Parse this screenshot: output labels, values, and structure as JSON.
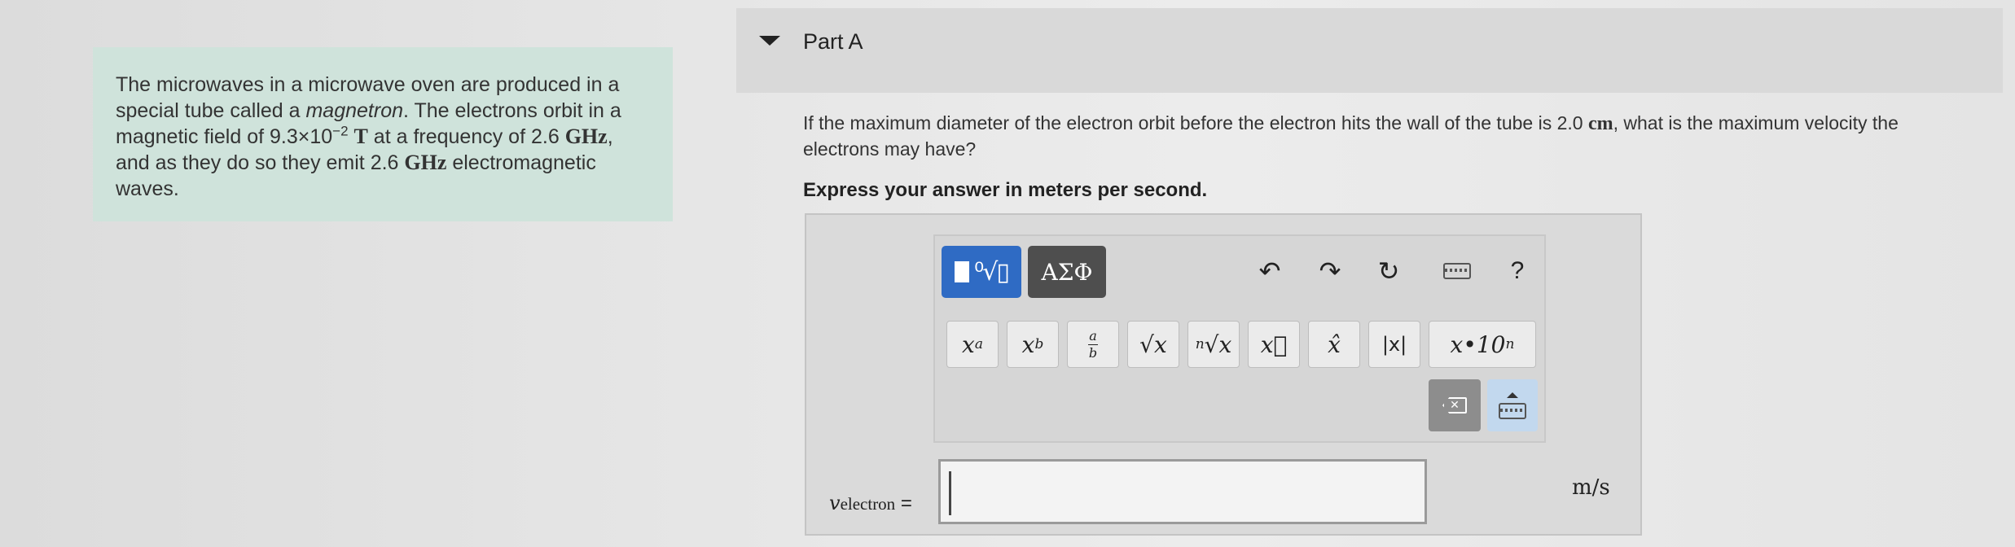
{
  "problem": {
    "t1": "The microwaves in a microwave oven are produced in a special tube called a ",
    "t2": "magnetron",
    "t3": ". The electrons orbit in a magnetic field of ",
    "field_mantissa": "9.3×10",
    "field_exponent": "−2",
    "field_unit": "T",
    "t4": " at a frequency of ",
    "freq1_value": "2.6",
    "freq1_unit": "GHz",
    "t5": ", and as they do so they emit ",
    "freq2_value": "2.6",
    "freq2_unit": "GHz",
    "t6": " electromagnetic waves."
  },
  "part": {
    "title": "Part A"
  },
  "question": {
    "t1": "If the maximum diameter of the electron orbit before the electron hits the wall of the tube is ",
    "d_value": "2.0",
    "d_unit": "cm",
    "t2": ", what is the maximum velocity the electrons may have?"
  },
  "instruction": "Express your answer in meters per second.",
  "toolbar": {
    "greek_label": "ΑΣΦ",
    "help_label": "?",
    "buttons": {
      "superscript_base": "x",
      "superscript_exp": "a",
      "subscript_base": "x",
      "subscript_sub": "b",
      "frac_num": "a",
      "frac_den": "b",
      "sqrt": "√x",
      "nroot_index": "n",
      "nroot": "√x",
      "vector": "x⃗",
      "unitvec": "x̂",
      "abs": "|x|",
      "sci_base": "x•10",
      "sci_exp": "n"
    }
  },
  "answer": {
    "var_symbol": "v",
    "var_subscript": "electron",
    "equals": " =",
    "value": "",
    "unit": "m/s"
  },
  "colors": {
    "problem_bg": "#cfe3db",
    "templates_btn": "#2f6bc4",
    "greek_btn": "#4e4e4e",
    "keyboard_btn": "#c2d8ee"
  },
  "icons": [
    "caret-down-icon",
    "templates-icon",
    "undo-icon",
    "redo-icon",
    "reset-icon",
    "keyboard-icon",
    "help-icon",
    "backspace-icon",
    "keyboard-toggle-icon"
  ]
}
